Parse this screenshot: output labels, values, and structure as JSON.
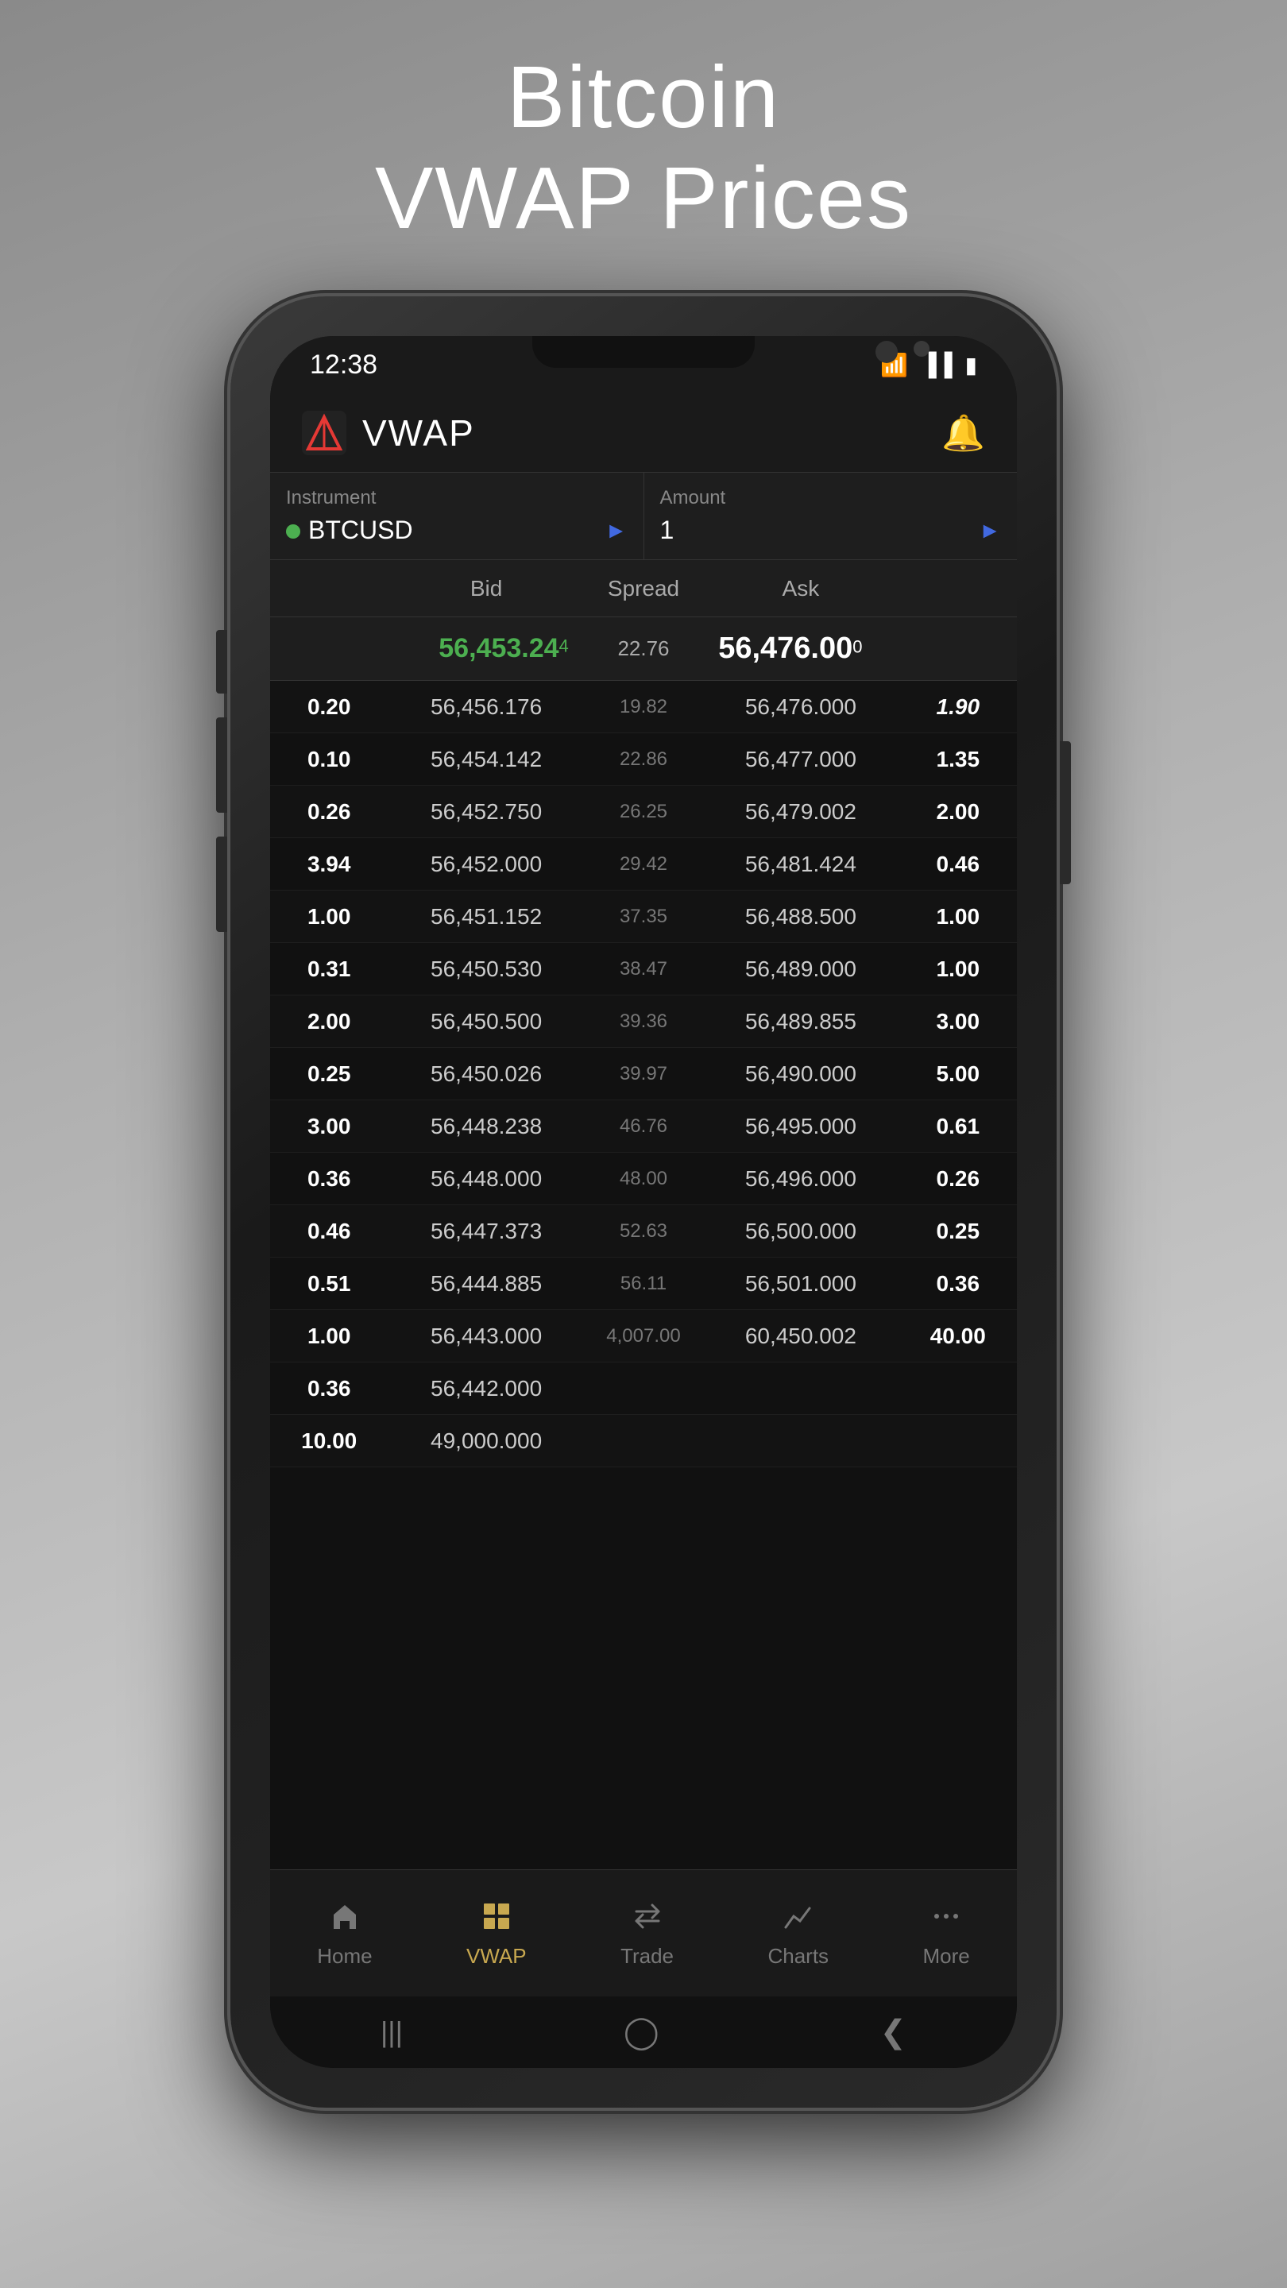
{
  "page": {
    "title_line1": "Bitcoin",
    "title_line2": "VWAP Prices"
  },
  "status_bar": {
    "time": "12:38",
    "icons": [
      "wifi",
      "signal",
      "battery"
    ]
  },
  "top_nav": {
    "title": "VWAP",
    "bell_icon": "🔔"
  },
  "controls": {
    "instrument_label": "Instrument",
    "instrument_value": "BTCUSD",
    "amount_label": "Amount",
    "amount_value": "1"
  },
  "table_headers": {
    "bid": "Bid",
    "spread": "Spread",
    "ask": "Ask"
  },
  "current_price": {
    "bid": "56,453.24",
    "bid_sup": "4",
    "spread": "22.76",
    "ask": "56,476.00",
    "ask_sup": "0"
  },
  "rows": [
    {
      "qty_bid": "0.20",
      "bid": "56,456.176",
      "spread": "19.82",
      "ask": "56,476.000",
      "qty_ask": "1.90",
      "qty_ask_style": "italic",
      "highlight": false
    },
    {
      "qty_bid": "0.10",
      "bid": "56,454.142",
      "spread": "22.86",
      "ask": "56,477.000",
      "qty_ask": "1.35",
      "qty_ask_style": "",
      "highlight": false
    },
    {
      "qty_bid": "0.26",
      "bid": "56,452.750",
      "spread": "26.25",
      "ask": "56,479.002",
      "qty_ask": "2.00",
      "qty_ask_style": "",
      "highlight": false
    },
    {
      "qty_bid": "3.94",
      "bid": "56,452.000",
      "spread": "29.42",
      "ask": "56,481.424",
      "qty_ask": "0.46",
      "qty_ask_style": "",
      "highlight": false
    },
    {
      "qty_bid": "1.00",
      "bid": "56,451.152",
      "spread": "37.35",
      "ask": "56,488.500",
      "qty_ask": "1.00",
      "qty_ask_style": "",
      "highlight": false
    },
    {
      "qty_bid": "0.31",
      "bid": "56,450.530",
      "spread": "38.47",
      "ask": "56,489.000",
      "qty_ask": "1.00",
      "qty_ask_style": "",
      "highlight": false
    },
    {
      "qty_bid": "2.00",
      "bid": "56,450.500",
      "spread": "39.36",
      "ask": "56,489.855",
      "qty_ask": "3.00",
      "qty_ask_style": "",
      "highlight": false
    },
    {
      "qty_bid": "0.25",
      "bid": "56,450.026",
      "spread": "39.97",
      "ask": "56,490.000",
      "qty_ask": "5.00",
      "qty_ask_style": "",
      "highlight": false
    },
    {
      "qty_bid": "3.00",
      "bid": "56,448.238",
      "spread": "46.76",
      "ask": "56,495.000",
      "qty_ask": "0.61",
      "qty_ask_style": "",
      "highlight": false
    },
    {
      "qty_bid": "0.36",
      "bid": "56,448.000",
      "spread": "48.00",
      "ask": "56,496.000",
      "qty_ask": "0.26",
      "qty_ask_style": "",
      "highlight": false
    },
    {
      "qty_bid": "0.46",
      "bid": "56,447.373",
      "spread": "52.63",
      "ask": "56,500.000",
      "qty_ask": "0.25",
      "qty_ask_style": "",
      "highlight": false
    },
    {
      "qty_bid": "0.51",
      "bid": "56,444.885",
      "spread": "56.11",
      "ask": "56,501.000",
      "qty_ask": "0.36",
      "qty_ask_style": "",
      "highlight": false
    },
    {
      "qty_bid": "1.00",
      "bid": "56,443.000",
      "spread": "4,007.00",
      "ask": "60,450.002",
      "qty_ask": "40.00",
      "qty_ask_style": "",
      "highlight": false
    },
    {
      "qty_bid": "0.36",
      "bid": "56,442.000",
      "spread": "",
      "ask": "",
      "qty_ask": "",
      "qty_ask_style": "",
      "highlight": false
    },
    {
      "qty_bid": "10.00",
      "bid": "49,000.000",
      "spread": "",
      "ask": "",
      "qty_ask": "",
      "qty_ask_style": "",
      "highlight": false
    }
  ],
  "bottom_nav": {
    "items": [
      {
        "label": "Home",
        "icon": "🏠",
        "active": false
      },
      {
        "label": "VWAP",
        "icon": "⊞",
        "active": true
      },
      {
        "label": "Trade",
        "icon": "⇄",
        "active": false
      },
      {
        "label": "Charts",
        "icon": "📈",
        "active": false
      },
      {
        "label": "More",
        "icon": "···",
        "active": false
      }
    ]
  },
  "android_nav": {
    "back": "‹",
    "home": "○",
    "recent": "|||"
  }
}
